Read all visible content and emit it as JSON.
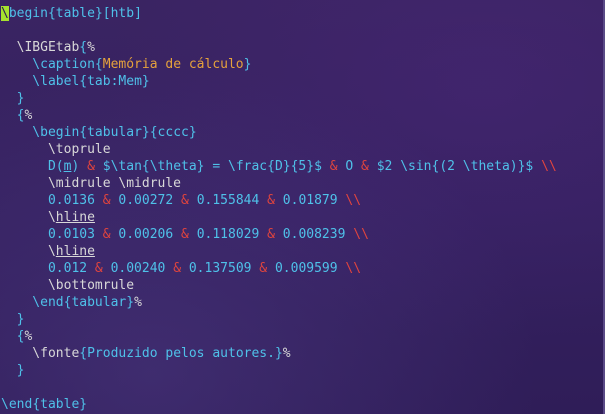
{
  "editor": {
    "lines": [
      {
        "parts": [
          [
            "cursor",
            "\\"
          ],
          [
            "kw",
            "begin"
          ],
          [
            "kw",
            "{"
          ],
          [
            "kw",
            "table"
          ],
          [
            "kw",
            "}"
          ],
          [
            "kw",
            "[htb]"
          ]
        ]
      },
      {
        "parts": []
      },
      {
        "parts": [
          [
            "cmd",
            "  \\IBGEtab"
          ],
          [
            "kw",
            "{"
          ],
          [
            "pct",
            "%"
          ]
        ]
      },
      {
        "parts": [
          [
            "kw",
            "    \\caption"
          ],
          [
            "kw",
            "{"
          ],
          [
            "str",
            "Memória de cálculo"
          ],
          [
            "kw",
            "}"
          ]
        ]
      },
      {
        "parts": [
          [
            "kw",
            "    \\label"
          ],
          [
            "kw",
            "{"
          ],
          [
            "arg",
            "tab:Mem"
          ],
          [
            "kw",
            "}"
          ]
        ]
      },
      {
        "parts": [
          [
            "kw",
            "  }"
          ]
        ]
      },
      {
        "parts": [
          [
            "kw",
            "  {"
          ],
          [
            "pct",
            "%"
          ]
        ]
      },
      {
        "parts": [
          [
            "kw",
            "    \\begin"
          ],
          [
            "kw",
            "{"
          ],
          [
            "arg",
            "tabular"
          ],
          [
            "kw",
            "}"
          ],
          [
            "kw",
            "{cccc}"
          ]
        ]
      },
      {
        "parts": [
          [
            "cmd",
            "      \\toprule"
          ]
        ]
      },
      {
        "parts": [
          [
            "kw",
            "      D("
          ],
          [
            "kwul",
            "m"
          ],
          [
            "kw",
            ")"
          ],
          [
            "amp",
            " & "
          ],
          [
            "kw",
            "$\\tan{\\theta} = \\frac{D}{5}$"
          ],
          [
            "amp",
            " & "
          ],
          [
            "kw",
            "O"
          ],
          [
            "amp",
            " & "
          ],
          [
            "kw",
            "$2 \\sin{(2 \\theta)}$"
          ],
          [
            "amp",
            " \\\\"
          ]
        ]
      },
      {
        "parts": [
          [
            "cmd",
            "      \\midrule \\midrule"
          ]
        ]
      },
      {
        "parts": [
          [
            "kw",
            "      0.0136"
          ],
          [
            "amp",
            " & "
          ],
          [
            "kw",
            "0.00272"
          ],
          [
            "amp",
            " & "
          ],
          [
            "kw",
            "0.155844"
          ],
          [
            "amp",
            " & "
          ],
          [
            "kw",
            "0.01879"
          ],
          [
            "amp",
            " \\\\"
          ]
        ]
      },
      {
        "parts": [
          [
            "cmd",
            "      \\"
          ],
          [
            "cmdul",
            "hline"
          ]
        ]
      },
      {
        "parts": [
          [
            "kw",
            "      0.0103"
          ],
          [
            "amp",
            " & "
          ],
          [
            "kw",
            "0.00206"
          ],
          [
            "amp",
            " & "
          ],
          [
            "kw",
            "0.118029"
          ],
          [
            "amp",
            " & "
          ],
          [
            "kw",
            "0.008239"
          ],
          [
            "amp",
            " \\\\"
          ]
        ]
      },
      {
        "parts": [
          [
            "cmd",
            "      \\"
          ],
          [
            "cmdul",
            "hline"
          ]
        ]
      },
      {
        "parts": [
          [
            "kw",
            "      0.012"
          ],
          [
            "amp",
            " & "
          ],
          [
            "kw",
            "0.00240"
          ],
          [
            "amp",
            " & "
          ],
          [
            "kw",
            "0.137509"
          ],
          [
            "amp",
            " & "
          ],
          [
            "kw",
            "0.009599"
          ],
          [
            "amp",
            " \\\\"
          ]
        ]
      },
      {
        "parts": [
          [
            "cmd",
            "      \\bottomrule"
          ]
        ]
      },
      {
        "parts": [
          [
            "kw",
            "    \\end"
          ],
          [
            "kw",
            "{"
          ],
          [
            "arg",
            "tabular"
          ],
          [
            "kw",
            "}"
          ],
          [
            "pct",
            "%"
          ]
        ]
      },
      {
        "parts": [
          [
            "kw",
            "  }"
          ]
        ]
      },
      {
        "parts": [
          [
            "kw",
            "  {"
          ],
          [
            "pct",
            "%"
          ]
        ]
      },
      {
        "parts": [
          [
            "cmd",
            "    \\fonte"
          ],
          [
            "kw",
            "{"
          ],
          [
            "kw",
            "Produzido pelos autores."
          ],
          [
            "kw",
            "}"
          ],
          [
            "pct",
            "%"
          ]
        ]
      },
      {
        "parts": [
          [
            "kw",
            "  }"
          ]
        ]
      },
      {
        "parts": []
      },
      {
        "parts": [
          [
            "kw",
            "\\end"
          ],
          [
            "kw",
            "{"
          ],
          [
            "arg",
            "table"
          ],
          [
            "kw",
            "}"
          ]
        ]
      }
    ]
  },
  "colors": {
    "background": "#3a2461",
    "cursor": "#a6e22e",
    "command": "#4fc1e9",
    "caption_text": "#e6a23c",
    "ampersand": "#e0443e"
  }
}
